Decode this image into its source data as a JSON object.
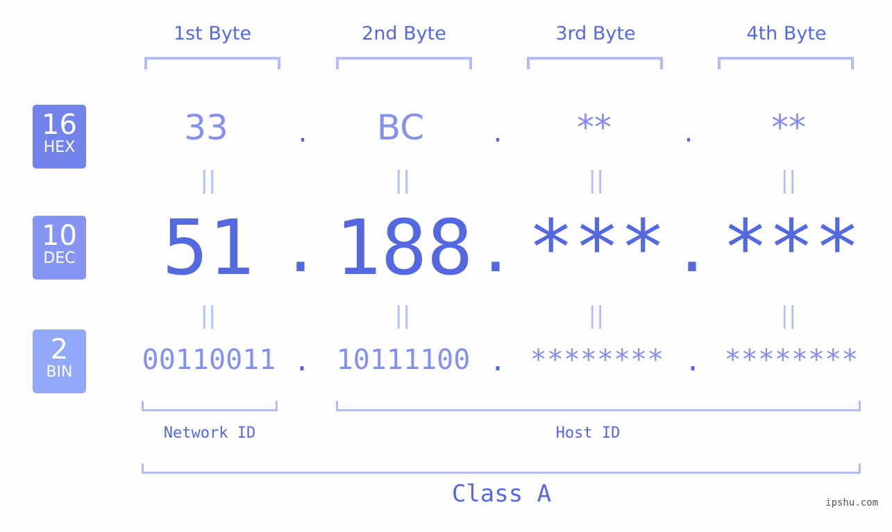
{
  "byte_headers": [
    "1st Byte",
    "2nd Byte",
    "3rd Byte",
    "4th Byte"
  ],
  "badges": [
    {
      "num": "16",
      "label": "HEX",
      "color": "#7383ec"
    },
    {
      "num": "10",
      "label": "DEC",
      "color": "#8595f1"
    },
    {
      "num": "2",
      "label": "BIN",
      "color": "#91a8f8"
    }
  ],
  "hex": [
    "33",
    "BC",
    "**",
    "**"
  ],
  "dec": [
    "51",
    "188",
    "***",
    "***"
  ],
  "bin": [
    "00110011",
    "10111100",
    "********",
    "********"
  ],
  "separator": ".",
  "equals": "||",
  "network_label": "Network ID",
  "host_label": "Host ID",
  "class_label": "Class A",
  "watermark": "ipshu.com",
  "colors": {
    "accent": "#5468e0",
    "light_value": "#8490ee",
    "bracket": "#b3bcf6"
  }
}
